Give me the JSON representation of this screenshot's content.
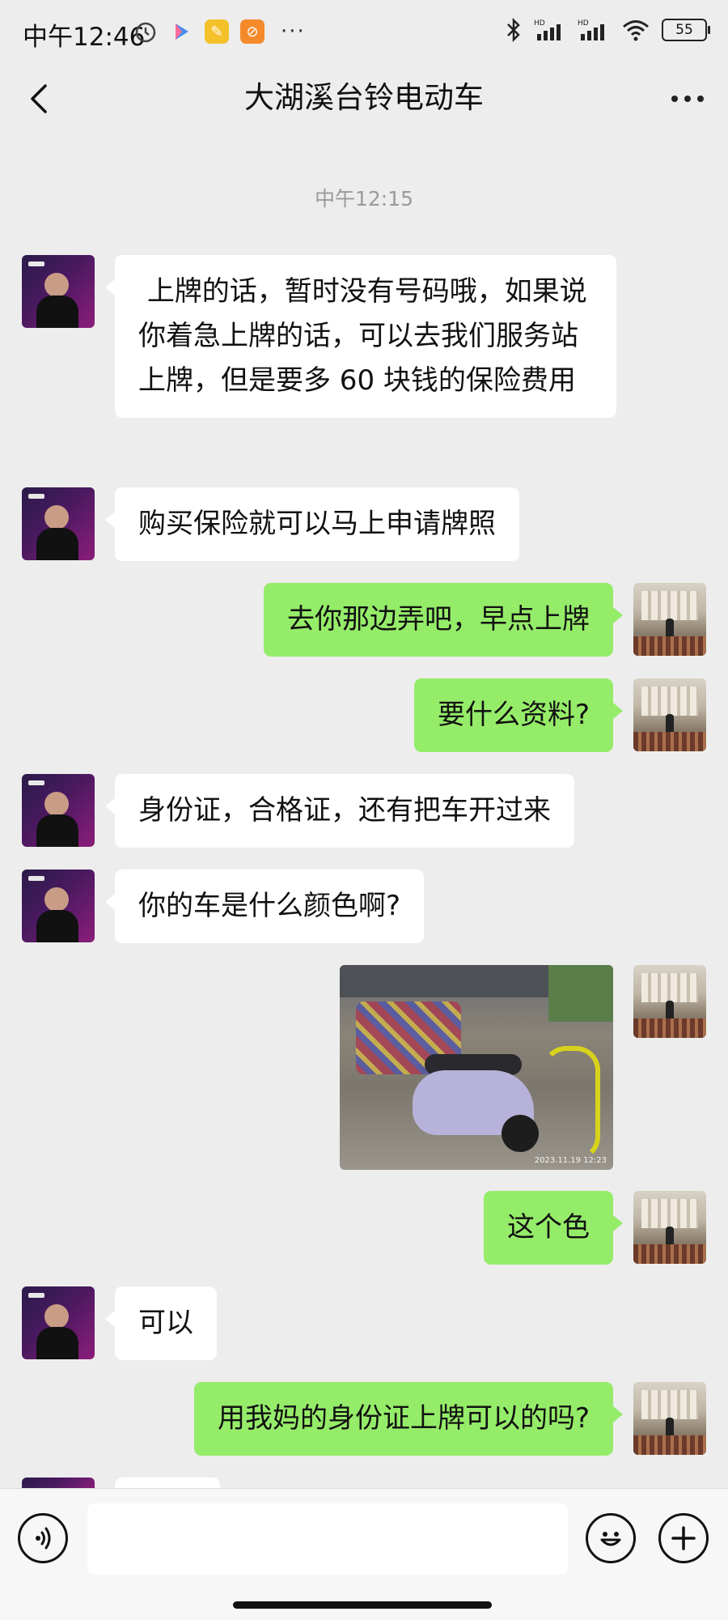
{
  "status_bar": {
    "time": "中午12:46",
    "more": "···",
    "battery": "55",
    "app_icons": [
      "alarm-icon",
      "play-icon",
      "app-icon",
      "app-icon-orange"
    ]
  },
  "header": {
    "title": "大湖溪台铃电动车"
  },
  "chat": {
    "timestamp": "中午12:15",
    "messages": [
      {
        "side": "left",
        "type": "text",
        "text": " 上牌的话，暂时没有号码哦，如果说你着急上牌的话，可以去我们服务站上牌，但是要多 60 块钱的保险费用"
      },
      {
        "side": "left",
        "type": "text",
        "text": "购买保险就可以马上申请牌照"
      },
      {
        "side": "right",
        "type": "text",
        "text": "去你那边弄吧，早点上牌"
      },
      {
        "side": "right",
        "type": "text",
        "text": "要什么资料?"
      },
      {
        "side": "left",
        "type": "text",
        "text": "身份证，合格证，还有把车开过来"
      },
      {
        "side": "left",
        "type": "text",
        "text": "你的车是什么颜色啊?"
      },
      {
        "side": "right",
        "type": "image",
        "text": "2023.11.19 12:23"
      },
      {
        "side": "right",
        "type": "text",
        "text": "这个色"
      },
      {
        "side": "left",
        "type": "text",
        "text": "可以"
      },
      {
        "side": "right",
        "type": "text",
        "text": "用我妈的身份证上牌可以的吗?"
      }
    ]
  },
  "input_bar": {
    "placeholder": ""
  },
  "colors": {
    "background": "#ededed",
    "bubble_self": "#95ec69",
    "bubble_other": "#ffffff"
  }
}
